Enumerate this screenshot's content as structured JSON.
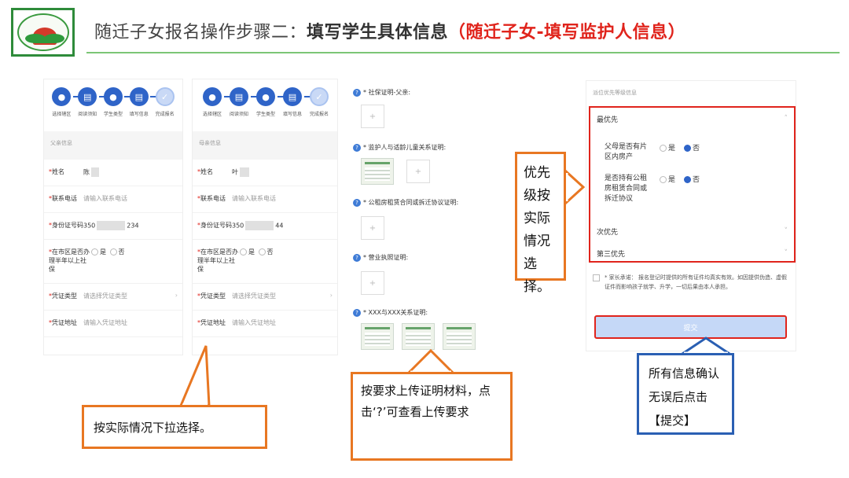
{
  "header": {
    "title_part1": "随迁子女报名操作步骤二：",
    "title_part2": "填写学生具体信息",
    "title_part3": "（随迁子女-填写监护人信息）"
  },
  "colors": {
    "accent_green": "#2e8b3a",
    "step_blue": "#2f64c8",
    "red": "#e0241c",
    "orange": "#e87722",
    "blue_border": "#2a5fb3"
  },
  "steps": [
    "选择辖区",
    "阅读须知",
    "学生类型",
    "填写信息",
    "完成报名"
  ],
  "panel1": {
    "section": "父亲信息",
    "rows": [
      {
        "label": "姓名",
        "value": "陈",
        "placeholder": false
      },
      {
        "label": "联系电话",
        "value": "请输入联系电话",
        "placeholder": true
      },
      {
        "label": "身份证号码",
        "value_pre": "350",
        "value_post": "234"
      },
      {
        "label": "在市区是否办理半年以上社保",
        "opt_yes": "是",
        "opt_no": "否"
      },
      {
        "label": "凭证类型",
        "value": "请选择凭证类型",
        "placeholder": true
      },
      {
        "label": "凭证地址",
        "value": "请输入凭证地址",
        "placeholder": true
      }
    ]
  },
  "panel2": {
    "section": "母亲信息",
    "rows": [
      {
        "label": "姓名",
        "value": "叶"
      },
      {
        "label": "联系电话",
        "value": "请输入联系电话"
      },
      {
        "label": "身份证号码",
        "value_pre": "350",
        "value_post": "44"
      },
      {
        "label": "在市区是否办理半年以上社保",
        "opt_yes": "是",
        "opt_no": "否"
      },
      {
        "label": "凭证类型",
        "value": "请选择凭证类型"
      },
      {
        "label": "凭证地址",
        "value": "请输入凭证地址"
      }
    ]
  },
  "uploads": [
    {
      "label": "* 社保证明-父亲:"
    },
    {
      "label": "* 监护人与适龄儿童关系证明:"
    },
    {
      "label": "* 公租房租赁合同或拆迁协议证明:"
    },
    {
      "label": "* 营业执照证明:"
    },
    {
      "label": "* XXX与XXX关系证明:"
    }
  ],
  "priority": {
    "heading": "派位优先等级信息",
    "first": "最优先",
    "q1": "父母是否有片区内房产",
    "q2": "是否持有公租房租赁合同或拆迁协议",
    "yes": "是",
    "no": "否",
    "second": "次优先",
    "third": "第三优先",
    "promise": "* 家长承诺：    报名登记时提供的所有证件均真实有效。如因提供伪造、虚假证件而影响孩子就学、升学，一切后果由本人承担。",
    "submit": "提交"
  },
  "callouts": {
    "dropdown": "按实际情况下拉选择。",
    "upload": "按要求上传证明材料，点击‘?’可查看上传要求",
    "priority": "优先级按实际情况选择。",
    "submit": "所有信息确认无误后点击【提交】"
  }
}
